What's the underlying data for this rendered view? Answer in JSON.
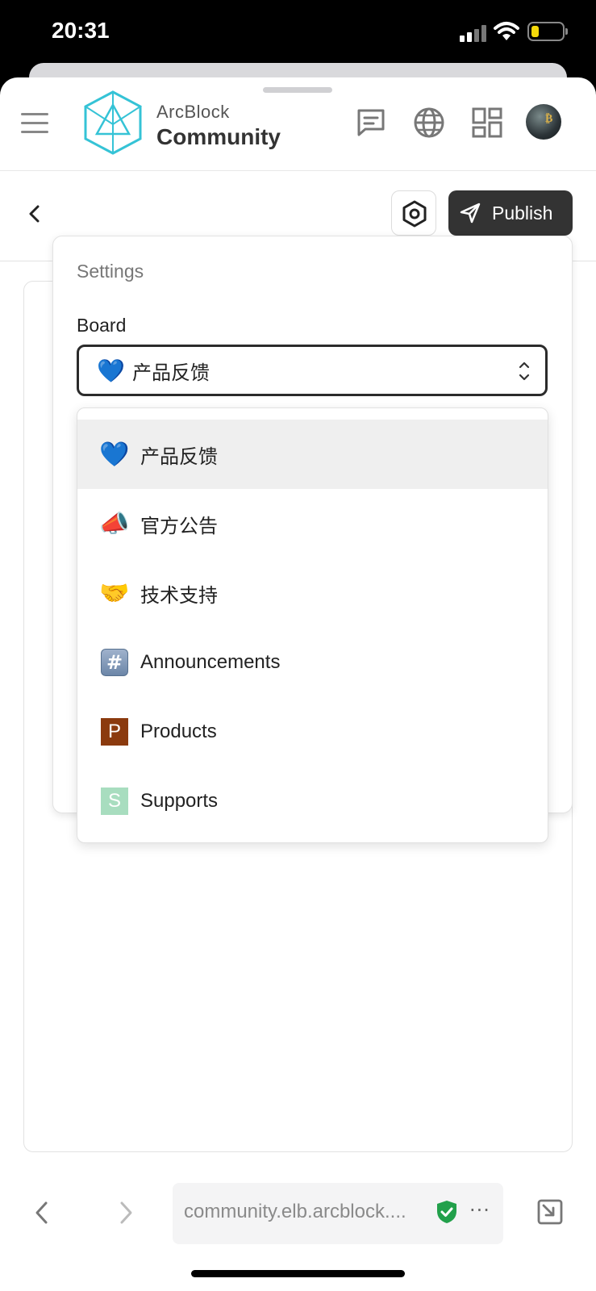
{
  "status_bar": {
    "time": "20:31"
  },
  "header": {
    "brand_top": "ArcBlock",
    "brand_bottom": "Community",
    "icons": [
      "menu-icon",
      "message-icon",
      "globe-icon",
      "apps-icon",
      "avatar"
    ]
  },
  "toolbar": {
    "publish_label": "Publish"
  },
  "settings": {
    "title": "Settings",
    "board_label": "Board",
    "selected": {
      "emoji": "💙",
      "label": "产品反馈"
    }
  },
  "board_options": [
    {
      "icon": "💙",
      "label": "产品反馈",
      "selected": true
    },
    {
      "icon": "📣",
      "label": "官方公告"
    },
    {
      "icon": "🤝",
      "label": "技术支持"
    },
    {
      "icon": "#",
      "label": "Announcements"
    },
    {
      "icon": "P",
      "label": "Products",
      "color": "#8b3a0e"
    },
    {
      "icon": "S",
      "label": "Supports",
      "color": "#a8ddbf"
    }
  ],
  "browser": {
    "url": "community.elb.arcblock...."
  }
}
